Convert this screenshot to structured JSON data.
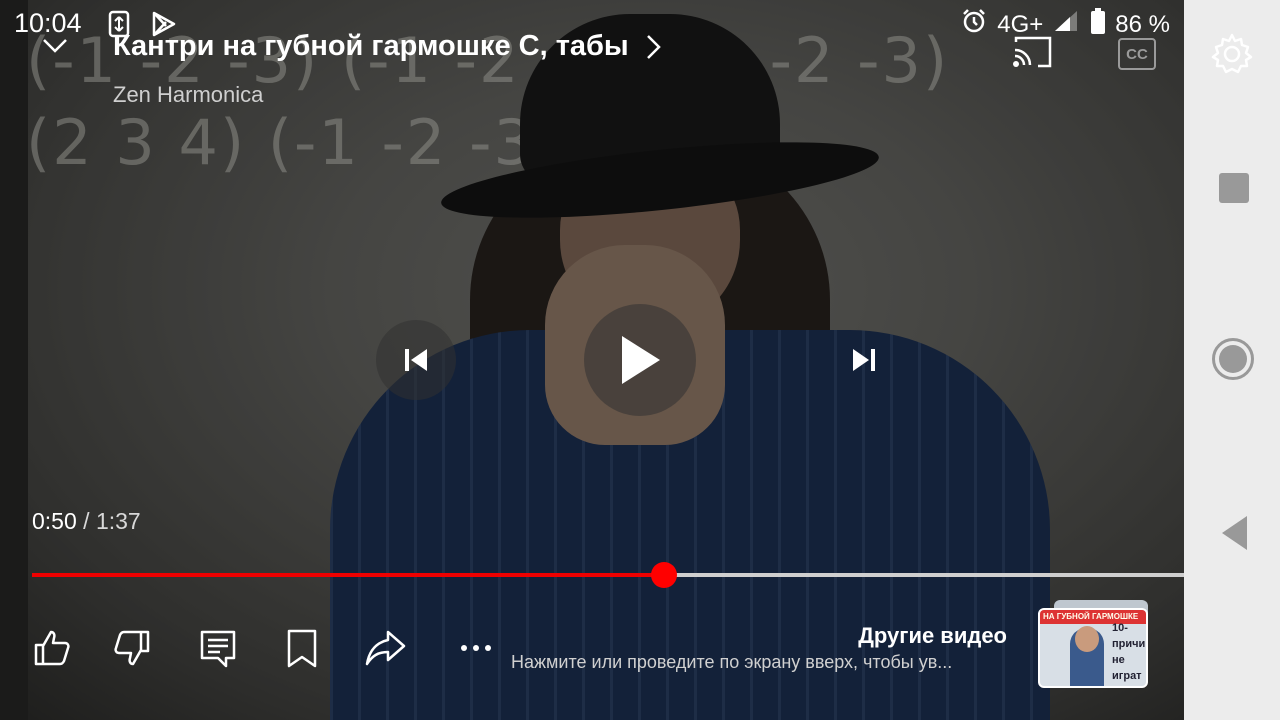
{
  "status_bar": {
    "time": "10:04",
    "network": "4G+",
    "battery": "86 %"
  },
  "player": {
    "title": "Кантри на губной гармошке С, табы",
    "channel": "Zen Harmonica",
    "position": "0:50",
    "separator": " / ",
    "duration": "1:37",
    "progress_fraction": 0.52,
    "cc_label": "CC"
  },
  "video_frame": {
    "tabs_line1": "(-1 -2 -3) (-1 -2 -3) (-1 -2 -3)",
    "tabs_line2": "(2 3 4) (-1 -2 -3)"
  },
  "more_videos": {
    "title": "Другие видео",
    "subtitle": "Нажмите или проведите по экрану вверх, чтобы ув...",
    "thumb_banner": "НА ГУБНОЙ ГАРМОШКЕ",
    "thumb_text": "10- причин не играт"
  },
  "colors": {
    "progress": "#ff0000",
    "accent": "#e00000"
  },
  "icons": {
    "actions": [
      "thumbs-up-icon",
      "thumbs-down-icon",
      "comment-icon",
      "save-icon",
      "share-icon",
      "more-icon"
    ]
  }
}
